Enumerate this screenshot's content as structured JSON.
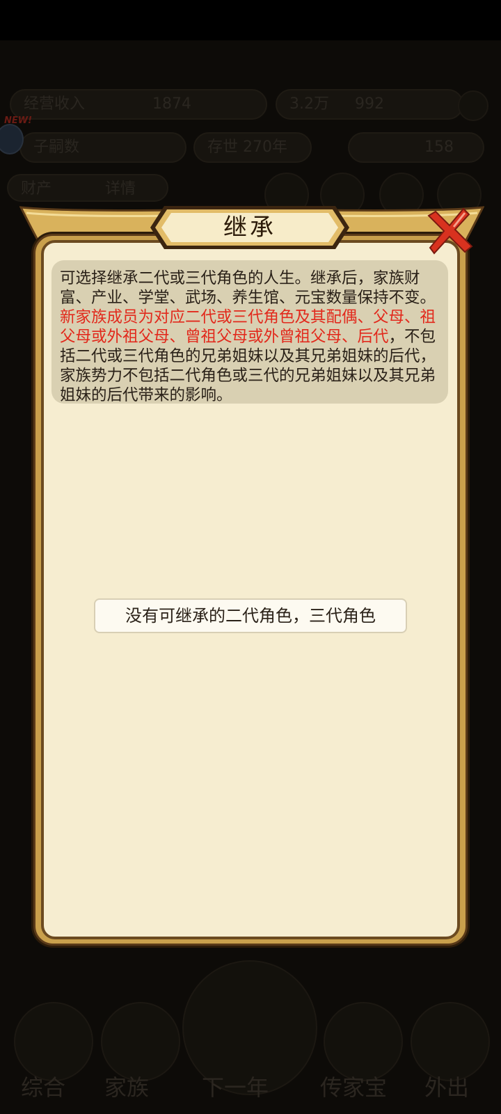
{
  "background": {
    "stat_labels": [
      "经营收入",
      "1874",
      "3.2万",
      "992",
      "子嗣数",
      "存世 270年",
      "158"
    ],
    "tabs": [
      "财产",
      "详情"
    ],
    "bottom_nav": [
      "综合",
      "家族",
      "下一年",
      "传家宝",
      "外出"
    ],
    "new_badge": "NEW!"
  },
  "modal": {
    "title": "继承",
    "info_part1": "可选择继承二代或三代角色的人生。继承后，家族财富、产业、学堂、武场、养生馆、元宝数量保持不变。",
    "info_red": "新家族成员为对应二代或三代角色及其配偶、父母、祖父母或外祖父母、曾祖父母或外曾祖父母、后代",
    "info_part2": "，不包括二代或三代角色的兄弟姐妹以及其兄弟姐妹的后代，家族势力不包括二代角色或三代的兄弟姐妹以及其兄弟姐妹的后代带来的影响。",
    "empty_message": "没有可继承的二代角色，三代角色"
  },
  "colors": {
    "frame_gold": "#c9a04c",
    "panel_cream": "#f6edd0",
    "highlight_red": "#e2291c",
    "close_red": "#d8321f"
  }
}
